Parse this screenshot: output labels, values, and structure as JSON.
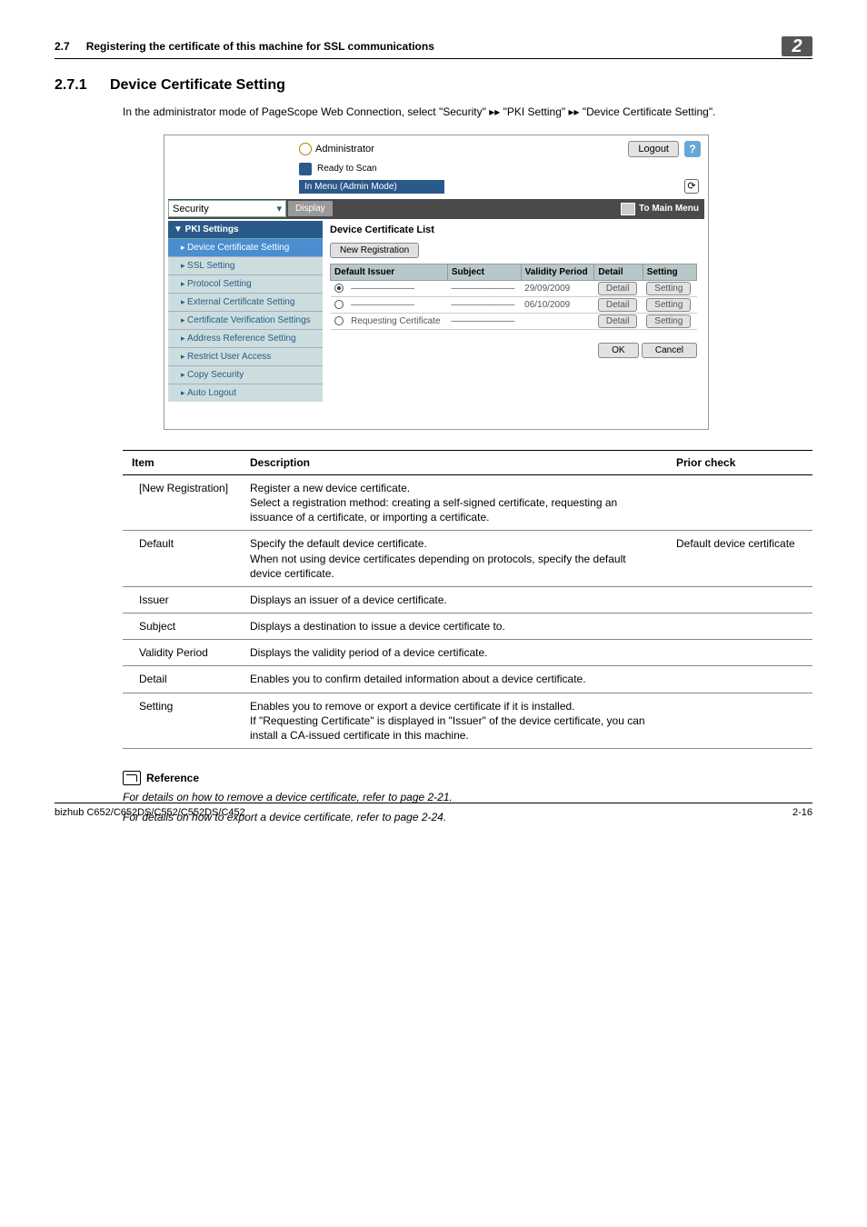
{
  "header": {
    "num": "2.7",
    "title": "Registering the certificate of this machine for SSL communications",
    "chapter": "2"
  },
  "section": {
    "num": "2.7.1",
    "title": "Device Certificate Setting"
  },
  "intro": {
    "pre": "In the administrator mode of PageScope Web Connection, select \"Security\" ",
    "mid1": "\"PKI Setting\" ",
    "mid2": "\"Device Certificate Setting\"."
  },
  "ss": {
    "admin": "Administrator",
    "logout": "Logout",
    "ready": "Ready to Scan",
    "menu": "In Menu (Admin Mode)",
    "security": "Security",
    "display": "Display",
    "mainmenu": "To Main Menu",
    "side_head": "▼ PKI Settings",
    "side": [
      "Device Certificate Setting",
      "SSL Setting",
      "Protocol Setting",
      "External Certificate Setting",
      "Certificate Verification Settings",
      "Address Reference Setting",
      "Restrict User Access",
      "Copy Security",
      "Auto Logout"
    ],
    "list_title": "Device Certificate List",
    "newreg": "New Registration",
    "th": {
      "default": "Default",
      "issuer": "Issuer",
      "subject": "Subject",
      "validity": "Validity Period",
      "detail": "Detail",
      "setting": "Setting"
    },
    "rows": [
      {
        "sel": true,
        "issuer": "—",
        "subject": "—",
        "validity": "29/09/2009"
      },
      {
        "sel": false,
        "issuer": "—",
        "subject": "—",
        "validity": "06/10/2009"
      },
      {
        "sel": false,
        "issuer": "Requesting Certificate",
        "subject": "—",
        "validity": ""
      }
    ],
    "detail_btn": "Detail",
    "setting_btn": "Setting",
    "ok": "OK",
    "cancel": "Cancel"
  },
  "table": {
    "head": {
      "item": "Item",
      "desc": "Description",
      "prior": "Prior check"
    },
    "rows": [
      {
        "item": "[New Registration]",
        "desc": "Register a new device certificate.\nSelect a registration method: creating a self-signed certificate, requesting an issuance of a certificate, or importing a certificate.",
        "prior": ""
      },
      {
        "item": "Default",
        "desc": "Specify the default device certificate.\nWhen not using device certificates depending on protocols, specify the default device certificate.",
        "prior": "Default device certificate"
      },
      {
        "item": "Issuer",
        "desc": "Displays an issuer of a device certificate.",
        "prior": ""
      },
      {
        "item": "Subject",
        "desc": "Displays a destination to issue a device certificate to.",
        "prior": ""
      },
      {
        "item": "Validity Period",
        "desc": "Displays the validity period of a device certificate.",
        "prior": ""
      },
      {
        "item": "Detail",
        "desc": "Enables you to confirm detailed information about a device certificate.",
        "prior": ""
      },
      {
        "item": "Setting",
        "desc": "Enables you to remove or export a device certificate if it is installed.\nIf \"Requesting Certificate\" is displayed in \"Issuer\" of the device certificate, you can install a CA-issued certificate in this machine.",
        "prior": ""
      }
    ]
  },
  "ref": {
    "title": "Reference",
    "l1": "For details on how to remove a device certificate, refer to page 2-21.",
    "l2": "For details on how to export a device certificate, refer to page 2-24."
  },
  "footer": {
    "left": "bizhub C652/C652DS/C552/C552DS/C452",
    "right": "2-16"
  }
}
